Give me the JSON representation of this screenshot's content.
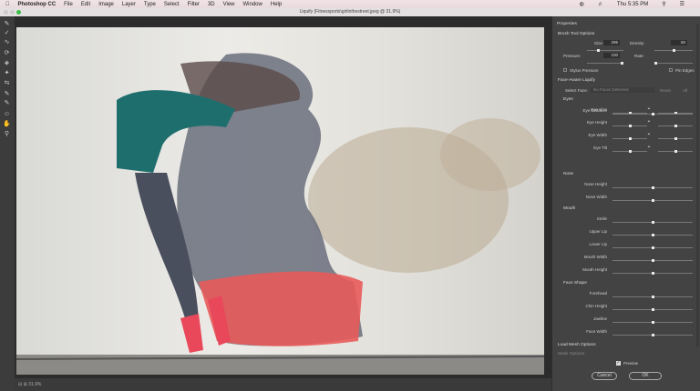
{
  "menubar": {
    "apple": "",
    "app": "Photoshop CC",
    "items": [
      "File",
      "Edit",
      "Image",
      "Layer",
      "Type",
      "Select",
      "Filter",
      "3D",
      "View",
      "Window",
      "Help"
    ],
    "clock": "Thu 5:35 PM"
  },
  "window": {
    "title": "Liquify (Fitnessports\\girlinthestreet.jpeg @ 31.9%)"
  },
  "status": {
    "zoom": "31.9%"
  },
  "panel": {
    "title": "Properties",
    "brush": {
      "section": "Brush Tool Options",
      "size_label": "Size:",
      "size": "295",
      "size_pos": 0.3,
      "density_label": "Density:",
      "density": "50",
      "density_pos": 0.5,
      "pressure_label": "Pressure:",
      "pressure": "100",
      "pressure_pos": 1.0,
      "rate_label": "Rate:",
      "rate_pos": 0.0,
      "stylus": "Stylus Pressure",
      "pin": "Pin Edges"
    },
    "face": {
      "section": "Face-Aware Liquify",
      "select_label": "Select Face:",
      "select_value": "No Faces Detected",
      "reset": "Reset",
      "all": "All"
    },
    "groups": [
      {
        "name": "Eyes",
        "rows": [
          "Eye Size",
          "Eye Height",
          "Eye Width",
          "Eye Tilt"
        ],
        "paired": true
      },
      {
        "name": "",
        "rows": [
          "Eye Distance"
        ],
        "paired": false
      },
      {
        "name": "Nose",
        "rows": [
          "Nose Height",
          "Nose Width"
        ],
        "paired": false
      },
      {
        "name": "Mouth",
        "rows": [
          "Smile",
          "Upper Lip",
          "Lower Lip",
          "Mouth Width",
          "Mouth Height"
        ],
        "paired": false
      },
      {
        "name": "Face Shape",
        "rows": [
          "Forehead",
          "Chin Height",
          "Jawline",
          "Face Width"
        ],
        "paired": false
      }
    ],
    "load_mesh": "Load Mesh Options",
    "mesh": "Mask Options",
    "preview": "Preview",
    "preview_checked": true,
    "cancel": "Cancel",
    "ok": "OK"
  },
  "colors": {
    "accent_streak": "#e85a5a",
    "jacket": "#1f6e6e",
    "panel_bg": "#434343"
  }
}
